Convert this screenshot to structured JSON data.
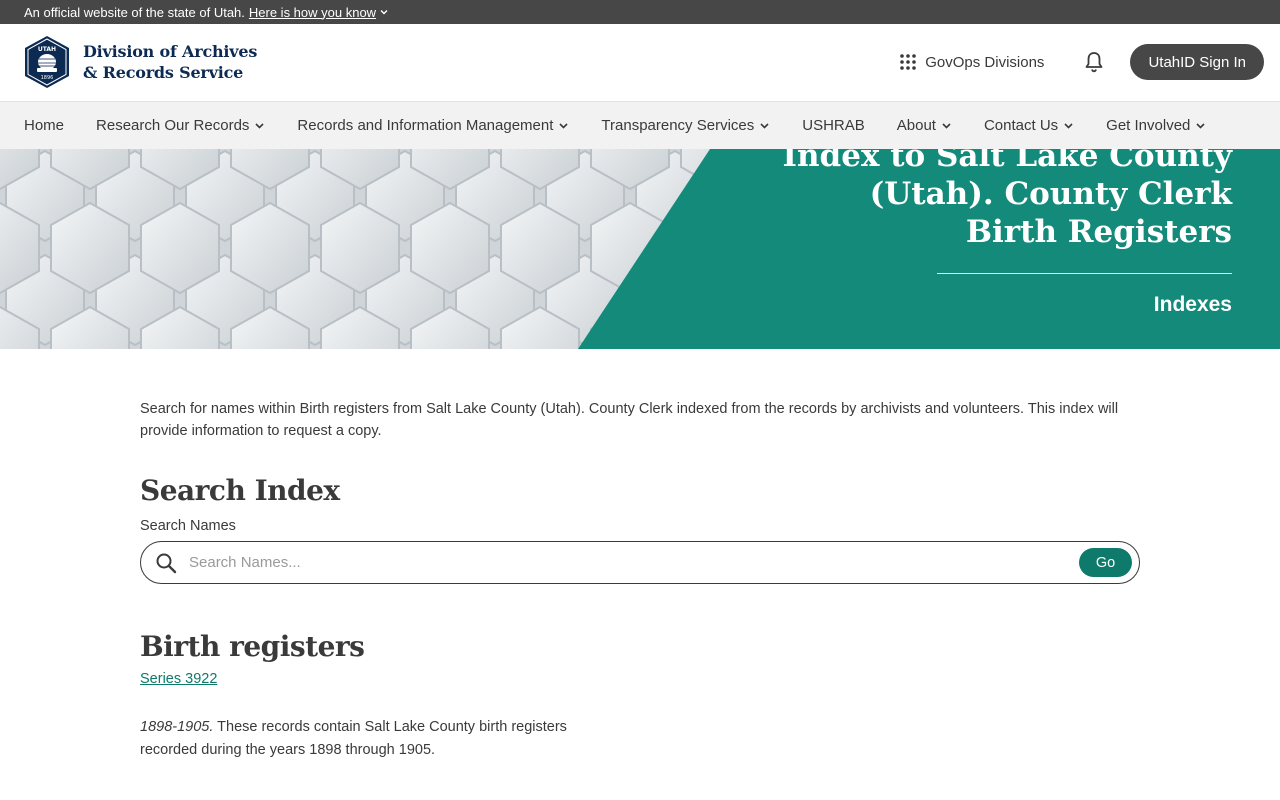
{
  "official_banner": {
    "text": "An official website of the state of Utah.",
    "link_label": "Here is how you know"
  },
  "header": {
    "logo": {
      "line1": "Division of Archives",
      "line2": "& Records Service",
      "seal_top": "UTAH",
      "seal_bottom": "1896"
    },
    "govops_label": "GovOps Divisions",
    "bell_icon": "bell-icon",
    "signin_label": "UtahID Sign In"
  },
  "nav": {
    "items": [
      {
        "label": "Home",
        "has_dropdown": false
      },
      {
        "label": "Research Our Records",
        "has_dropdown": true
      },
      {
        "label": "Records and Information Management",
        "has_dropdown": true
      },
      {
        "label": "Transparency Services",
        "has_dropdown": true
      },
      {
        "label": "USHRAB",
        "has_dropdown": false
      },
      {
        "label": "About",
        "has_dropdown": true
      },
      {
        "label": "Contact Us",
        "has_dropdown": true
      },
      {
        "label": "Get Involved",
        "has_dropdown": true
      }
    ]
  },
  "hero": {
    "title": "Index to Salt Lake County (Utah). County Clerk Birth Registers",
    "subtitle": "Indexes",
    "accent_color": "#138a7a"
  },
  "main": {
    "intro": "Search for names within Birth registers from Salt Lake County (Utah). County Clerk indexed from the records by archivists and volunteers. This index will provide information to request a copy.",
    "search": {
      "heading": "Search Index",
      "label": "Search Names",
      "placeholder": "Search Names...",
      "value": "",
      "button_label": "Go"
    },
    "records": {
      "heading": "Birth registers",
      "series_link": "Series 3922",
      "date_range": "1898-1905.",
      "description": " These records contain Salt Lake County birth registers recorded during the years 1898 through 1905."
    }
  },
  "colors": {
    "accent": "#0e7a6c",
    "banner_bg": "#474747",
    "nav_bg": "#f2f2f2",
    "logo_navy": "#0d2b52"
  }
}
